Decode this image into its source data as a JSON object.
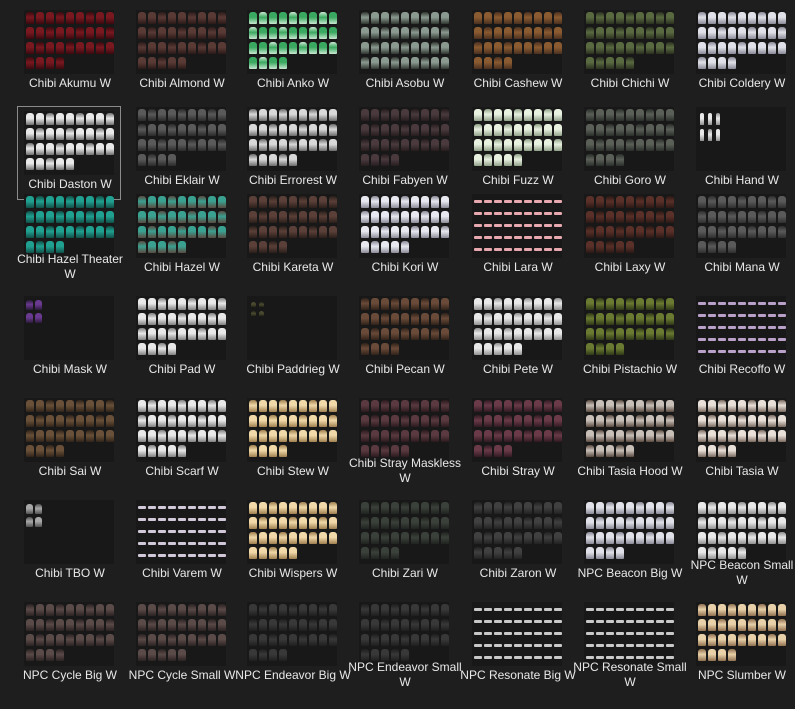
{
  "selected_index": 7,
  "files": [
    {
      "name": "Chibi Akumu W",
      "icon": "sprite-sheet-icon",
      "palette": [
        "#7a1820",
        "#3a0a0e"
      ],
      "pattern": "full"
    },
    {
      "name": "Chibi Almond W",
      "icon": "sprite-sheet-icon",
      "palette": [
        "#5a3a35",
        "#2a1a18"
      ],
      "pattern": "full"
    },
    {
      "name": "Chibi Anko W",
      "icon": "sprite-sheet-icon",
      "palette": [
        "#3aa860",
        "#c8e8d0"
      ],
      "pattern": "full"
    },
    {
      "name": "Chibi Asobu W",
      "icon": "sprite-sheet-icon",
      "palette": [
        "#8a9a90",
        "#303530"
      ],
      "pattern": "sparse"
    },
    {
      "name": "Chibi Cashew W",
      "icon": "sprite-sheet-icon",
      "palette": [
        "#8a5a30",
        "#4a3020"
      ],
      "pattern": "full"
    },
    {
      "name": "Chibi Chichi W",
      "icon": "sprite-sheet-icon",
      "palette": [
        "#5a6a40",
        "#2a3020"
      ],
      "pattern": "full"
    },
    {
      "name": "Chibi Coldery W",
      "icon": "sprite-sheet-icon",
      "palette": [
        "#e0e0e8",
        "#8a8a98"
      ],
      "pattern": "full-short"
    },
    {
      "name": "Chibi Daston W",
      "icon": "sprite-sheet-icon",
      "palette": [
        "#e8e8e8",
        "#707070"
      ],
      "pattern": "full-short"
    },
    {
      "name": "Chibi Eklair W",
      "icon": "sprite-sheet-icon",
      "palette": [
        "#5a5a5a",
        "#2a2a2a"
      ],
      "pattern": "full"
    },
    {
      "name": "Chibi Errorest W",
      "icon": "sprite-sheet-icon",
      "palette": [
        "#d8d8d8",
        "#6a6a6a"
      ],
      "pattern": "full"
    },
    {
      "name": "Chibi Fabyen W",
      "icon": "sprite-sheet-icon",
      "palette": [
        "#4a3a3e",
        "#261c1e"
      ],
      "pattern": "full"
    },
    {
      "name": "Chibi Fuzz W",
      "icon": "sprite-sheet-icon",
      "palette": [
        "#e8f0e0",
        "#90a088"
      ],
      "pattern": "full"
    },
    {
      "name": "Chibi Goro W",
      "icon": "sprite-sheet-icon",
      "palette": [
        "#5a6058",
        "#2a2e2a"
      ],
      "pattern": "full"
    },
    {
      "name": "Chibi Hand W",
      "icon": "sprite-sheet-icon",
      "palette": [
        "#e8e8e8",
        "#909090"
      ],
      "pattern": "hand"
    },
    {
      "name": "Chibi Hazel Theater W",
      "icon": "sprite-sheet-icon",
      "palette": [
        "#20a090",
        "#105048"
      ],
      "pattern": "full"
    },
    {
      "name": "Chibi Hazel W",
      "icon": "sprite-sheet-icon",
      "palette": [
        "#3aa090",
        "#5a4a40"
      ],
      "pattern": "full"
    },
    {
      "name": "Chibi Kareta W",
      "icon": "sprite-sheet-icon",
      "palette": [
        "#5a4038",
        "#2a1e1a"
      ],
      "pattern": "full"
    },
    {
      "name": "Chibi Kori W",
      "icon": "sprite-sheet-icon",
      "palette": [
        "#e8e8f0",
        "#8a8a98"
      ],
      "pattern": "full"
    },
    {
      "name": "Chibi Lara W",
      "icon": "sprite-sheet-icon",
      "palette": [
        "#e8a8b0",
        "#704048"
      ],
      "pattern": "dots"
    },
    {
      "name": "Chibi Laxy W",
      "icon": "sprite-sheet-icon",
      "palette": [
        "#5a3028",
        "#2a1814"
      ],
      "pattern": "full"
    },
    {
      "name": "Chibi Mana W",
      "icon": "sprite-sheet-icon",
      "palette": [
        "#5a5a5a",
        "#2e2e2e"
      ],
      "pattern": "full"
    },
    {
      "name": "Chibi Mask W",
      "icon": "sprite-sheet-icon",
      "palette": [
        "#6a3a90",
        "#2a1a3a"
      ],
      "pattern": "mask"
    },
    {
      "name": "Chibi Pad W",
      "icon": "sprite-sheet-icon",
      "palette": [
        "#e8e8e8",
        "#808080"
      ],
      "pattern": "full-short"
    },
    {
      "name": "Chibi Paddrieg W",
      "icon": "sprite-sheet-icon",
      "palette": [
        "#4a4a30",
        "#262618"
      ],
      "pattern": "tiny"
    },
    {
      "name": "Chibi Pecan W",
      "icon": "sprite-sheet-icon",
      "palette": [
        "#6a4a38",
        "#30221a"
      ],
      "pattern": "full"
    },
    {
      "name": "Chibi Pete W",
      "icon": "sprite-sheet-icon",
      "palette": [
        "#e8e8e8",
        "#909090"
      ],
      "pattern": "full"
    },
    {
      "name": "Chibi Pistachio W",
      "icon": "sprite-sheet-icon",
      "palette": [
        "#6a7a30",
        "#303818"
      ],
      "pattern": "full"
    },
    {
      "name": "Chibi Recoffo W",
      "icon": "sprite-sheet-icon",
      "palette": [
        "#b8a0c8",
        "#504060"
      ],
      "pattern": "dots"
    },
    {
      "name": "Chibi Sai W",
      "icon": "sprite-sheet-icon",
      "palette": [
        "#6a5038",
        "#30241a"
      ],
      "pattern": "full-short"
    },
    {
      "name": "Chibi Scarf W",
      "icon": "sprite-sheet-icon",
      "palette": [
        "#e8e8e8",
        "#808080"
      ],
      "pattern": "full-short"
    },
    {
      "name": "Chibi Stew W",
      "icon": "sprite-sheet-icon",
      "palette": [
        "#f0d8a8",
        "#a08050"
      ],
      "pattern": "full"
    },
    {
      "name": "Chibi Stray Maskless W",
      "icon": "sprite-sheet-icon",
      "palette": [
        "#5a3a40",
        "#2a1a1e"
      ],
      "pattern": "full"
    },
    {
      "name": "Chibi Stray W",
      "icon": "sprite-sheet-icon",
      "palette": [
        "#6a3a48",
        "#301a22"
      ],
      "pattern": "full"
    },
    {
      "name": "Chibi Tasia Hood W",
      "icon": "sprite-sheet-icon",
      "palette": [
        "#c8c0b8",
        "#5a4a40"
      ],
      "pattern": "full"
    },
    {
      "name": "Chibi Tasia W",
      "icon": "sprite-sheet-icon",
      "palette": [
        "#e8e0d8",
        "#7a6a60"
      ],
      "pattern": "full"
    },
    {
      "name": "Chibi TBO W",
      "icon": "sprite-sheet-icon",
      "palette": [
        "#a8a8a8",
        "#505050"
      ],
      "pattern": "mask"
    },
    {
      "name": "Chibi Varem W",
      "icon": "sprite-sheet-icon",
      "palette": [
        "#d0c8d8",
        "#605868"
      ],
      "pattern": "dots"
    },
    {
      "name": "Chibi Wispers W",
      "icon": "sprite-sheet-icon",
      "palette": [
        "#f0d8a8",
        "#a08050"
      ],
      "pattern": "full"
    },
    {
      "name": "Chibi Zari W",
      "icon": "sprite-sheet-icon",
      "palette": [
        "#3a403a",
        "#202420"
      ],
      "pattern": "full"
    },
    {
      "name": "Chibi Zaron W",
      "icon": "sprite-sheet-icon",
      "palette": [
        "#404040",
        "#222222"
      ],
      "pattern": "full"
    },
    {
      "name": "NPC Beacon Big W",
      "icon": "sprite-sheet-icon",
      "palette": [
        "#e0e0e8",
        "#8a8a98"
      ],
      "pattern": "full"
    },
    {
      "name": "NPC Beacon Small W",
      "icon": "sprite-sheet-icon",
      "palette": [
        "#e8e8e8",
        "#909090"
      ],
      "pattern": "full"
    },
    {
      "name": "NPC Cycle Big W",
      "icon": "sprite-sheet-icon",
      "palette": [
        "#5a4a48",
        "#2a2222"
      ],
      "pattern": "full"
    },
    {
      "name": "NPC Cycle Small W",
      "icon": "sprite-sheet-icon",
      "palette": [
        "#5a4a48",
        "#2a2222"
      ],
      "pattern": "full"
    },
    {
      "name": "NPC Endeavor Big W",
      "icon": "sprite-sheet-icon",
      "palette": [
        "#383838",
        "#1e1e1e"
      ],
      "pattern": "full"
    },
    {
      "name": "NPC Endeavor Small W",
      "icon": "sprite-sheet-icon",
      "palette": [
        "#383838",
        "#1e1e1e"
      ],
      "pattern": "full"
    },
    {
      "name": "NPC Resonate Big W",
      "icon": "sprite-sheet-icon",
      "palette": [
        "#c8c8c8",
        "#606060"
      ],
      "pattern": "dots"
    },
    {
      "name": "NPC Resonate Small W",
      "icon": "sprite-sheet-icon",
      "palette": [
        "#c8c8c8",
        "#606060"
      ],
      "pattern": "dots"
    },
    {
      "name": "NPC Slumber W",
      "icon": "sprite-sheet-icon",
      "palette": [
        "#e8d0a8",
        "#907050"
      ],
      "pattern": "full-short"
    }
  ]
}
